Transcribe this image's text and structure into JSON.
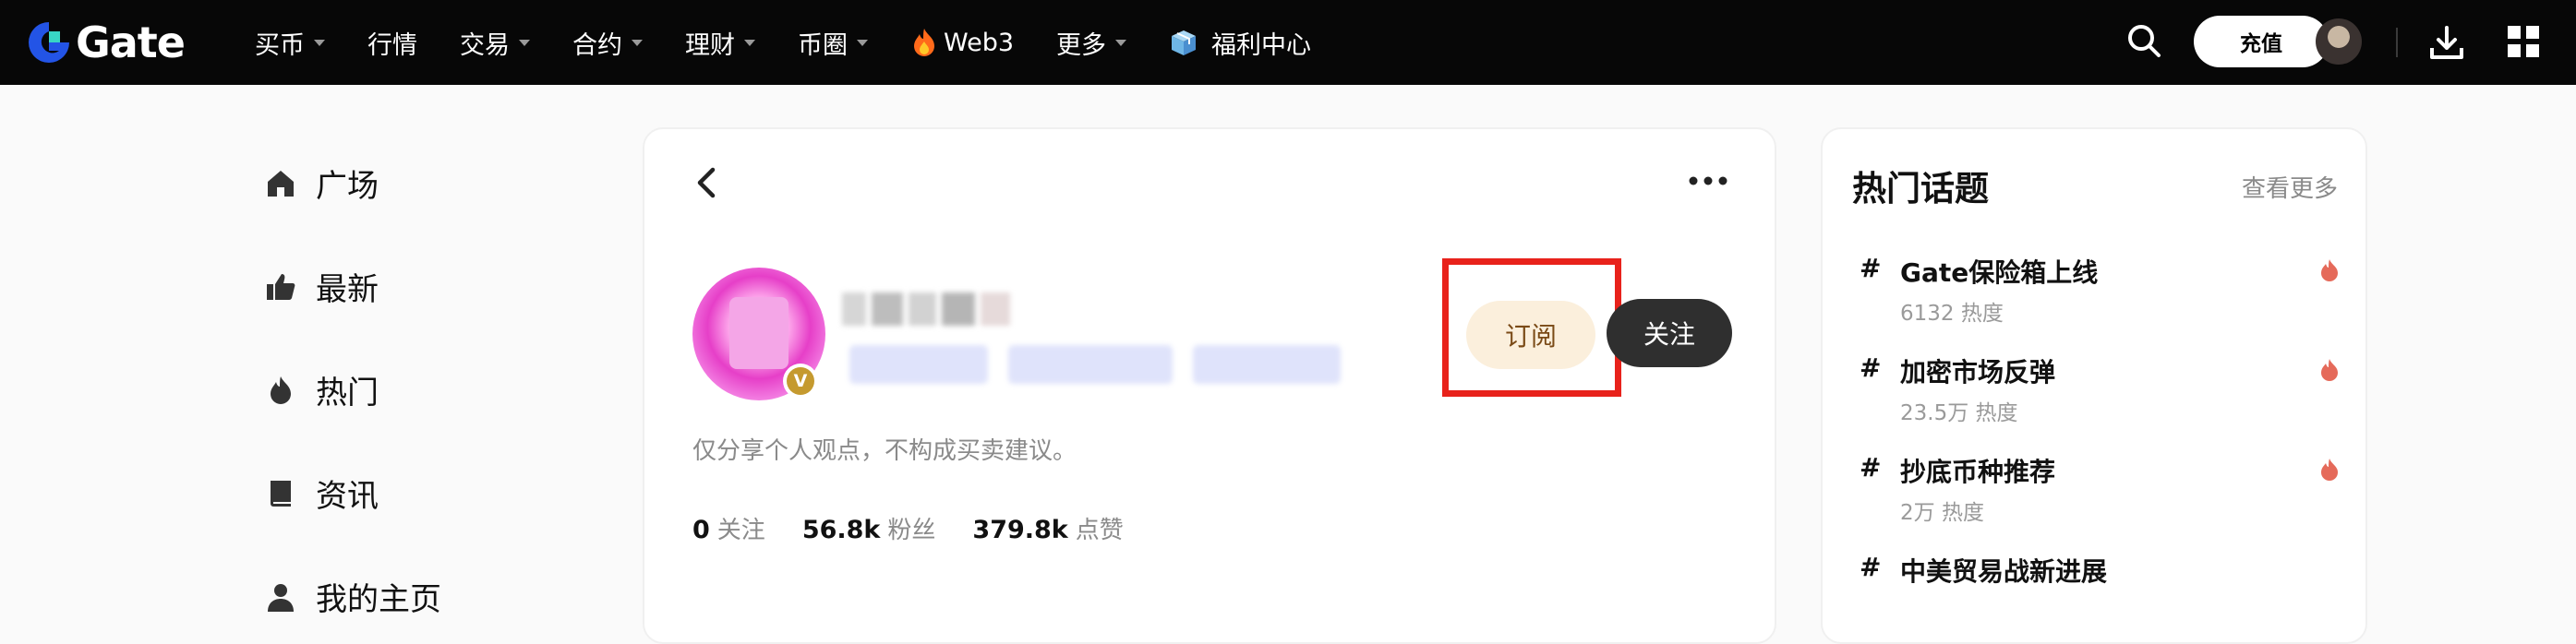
{
  "brand": {
    "logo_text": "Gate"
  },
  "nav": {
    "items": [
      {
        "label": "买币",
        "dropdown": true
      },
      {
        "label": "行情",
        "dropdown": false
      },
      {
        "label": "交易",
        "dropdown": true
      },
      {
        "label": "合约",
        "dropdown": true
      },
      {
        "label": "理财",
        "dropdown": true
      },
      {
        "label": "币圈",
        "dropdown": true
      },
      {
        "label": "Web3",
        "dropdown": false,
        "icon": "fire-icon"
      },
      {
        "label": "更多",
        "dropdown": true
      },
      {
        "label": "福利中心",
        "dropdown": false,
        "icon": "gift-icon"
      }
    ]
  },
  "topbar_right": {
    "recharge_label": "充值",
    "icons": [
      "search-icon",
      "avatar",
      "download-icon",
      "grid-icon"
    ]
  },
  "sidebar": {
    "items": [
      {
        "label": "广场",
        "icon": "home-icon"
      },
      {
        "label": "最新",
        "icon": "thumbs-up-icon"
      },
      {
        "label": "热门",
        "icon": "flame-icon"
      },
      {
        "label": "资讯",
        "icon": "book-icon"
      },
      {
        "label": "我的主页",
        "icon": "user-icon"
      }
    ]
  },
  "profile": {
    "verified_badge": "V",
    "subscribe_label": "订阅",
    "follow_label": "关注",
    "bio": "仅分享个人观点，不构成买卖建议。",
    "stats": [
      {
        "value": "0",
        "label": "关注"
      },
      {
        "value": "56.8k",
        "label": "粉丝"
      },
      {
        "value": "379.8k",
        "label": "点赞"
      }
    ]
  },
  "hot_topics": {
    "title": "热门话题",
    "more_label": "查看更多",
    "items": [
      {
        "hash": "#",
        "name": "Gate保险箱上线",
        "heat": "6132 热度",
        "hot": true
      },
      {
        "hash": "#",
        "name": "加密市场反弹",
        "heat": "23.5万 热度",
        "hot": true
      },
      {
        "hash": "#",
        "name": "抄底币种推荐",
        "heat": "2万 热度",
        "hot": true
      },
      {
        "hash": "#",
        "name": "中美贸易战新进展",
        "heat": "",
        "hot": false
      }
    ]
  },
  "colors": {
    "topbar_bg": "#070707",
    "brand_blue": "#2354e6",
    "subscribe_bg": "#fbefdc",
    "follow_bg": "#2f2f2f",
    "highlight_box": "#e8221b",
    "hot_icon": "#e56a5a"
  }
}
